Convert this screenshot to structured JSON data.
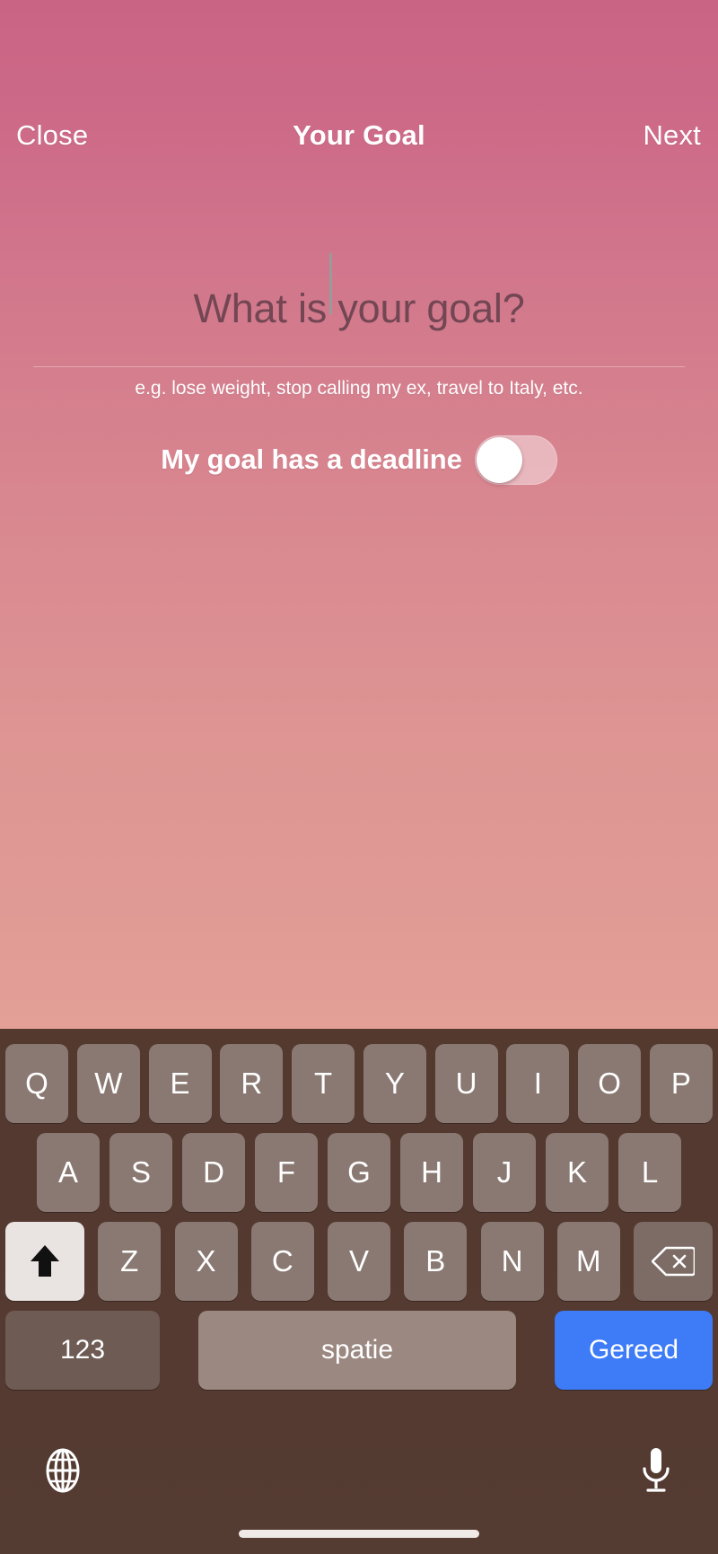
{
  "app": {
    "background_top_color": "#ca6485",
    "background_bottom_color": "#e3a096"
  },
  "navbar": {
    "close_label": "Close",
    "title": "Your Goal",
    "next_label": "Next"
  },
  "goal_form": {
    "input_value": "",
    "placeholder": "What is your goal?",
    "hint": "e.g. lose weight, stop calling my ex, travel to Italy, etc.",
    "deadline_label": "My goal has a deadline",
    "deadline_enabled": "off"
  },
  "keyboard": {
    "language": "Dutch",
    "row1": [
      "Q",
      "W",
      "E",
      "R",
      "T",
      "Y",
      "U",
      "I",
      "O",
      "P"
    ],
    "row2": [
      "A",
      "S",
      "D",
      "F",
      "G",
      "H",
      "J",
      "K",
      "L"
    ],
    "row3_letters": [
      "Z",
      "X",
      "C",
      "V",
      "B",
      "N",
      "M"
    ],
    "shift_icon": "shift-arrow-up-icon",
    "backspace_icon": "backspace-delete-icon",
    "numbers_label": "123",
    "space_label": "spatie",
    "done_label": "Gereed",
    "done_color": "#3d7bf7",
    "globe_icon": "globe-language-icon",
    "mic_icon": "microphone-dictation-icon"
  }
}
